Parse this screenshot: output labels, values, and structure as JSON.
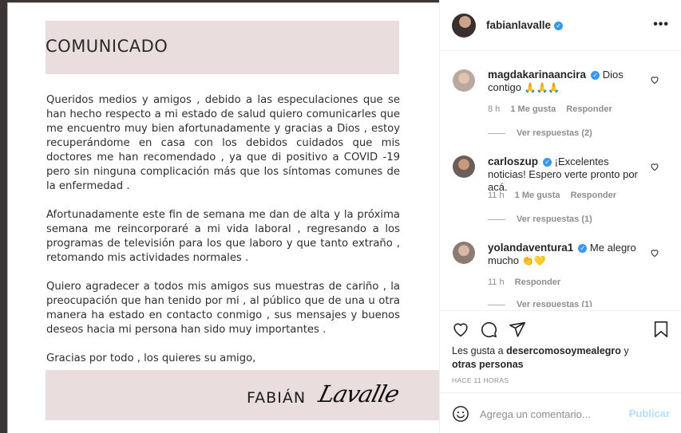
{
  "post": {
    "heading": "COMUNICADO",
    "paragraphs": [
      "Queridos medios y amigos , debido a las especulaciones que se han hecho respecto a mi estado de salud quiero comunicarles que me encuentro muy bien afortunadamente y gracias a Dios , estoy recuperándome en casa con los debidos cuidados que mis doctores me han recomendado ,  ya que di positivo a COVID -19 pero sin ninguna complicación más que los síntomas comunes de la enfermedad .",
      "Afortunadamente este fin de semana me dan de alta y la próxima semana me reincorporaré a mi vida laboral , regresando a los programas de televisión para los que laboro y que tanto  extraño , retomando mis actividades normales .",
      "Quiero agradecer a todos mis amigos sus muestras de cariño , la preocupación que han tenido  por mi , al público que de una u otra manera ha estado en contacto conmigo , sus mensajes y buenos deseos hacia mi persona han sido muy importantes .",
      "Gracias por todo , los quieres su amigo,"
    ],
    "signature_first": "FABIÁN",
    "signature_last": "Lavalle"
  },
  "header": {
    "username": "fabianlavalle",
    "verified_mark": "✓",
    "more": "•••"
  },
  "comments": [
    {
      "username": "magdakarinaancira",
      "verified": true,
      "text": "Dios contigo",
      "emoji": "🙏🙏🙏",
      "time": "8 h",
      "likes": "1 Me gusta",
      "reply": "Responder",
      "view_replies": "Ver respuestas (2)"
    },
    {
      "username": "carloszup",
      "verified": true,
      "text": "¡Excelentes noticias! Espero verte pronto por acá.",
      "emoji": "",
      "time": "11 h",
      "likes": "1 Me gusta",
      "reply": "Responder",
      "view_replies": "Ver respuestas (1)"
    },
    {
      "username": "yolandaventura1",
      "verified": true,
      "text": "Me alegro mucho",
      "emoji": "👏💛",
      "time": "11 h",
      "likes": "",
      "reply": "Responder",
      "view_replies": "Ver respuestas (1)"
    }
  ],
  "actions": {
    "likes_prefix": "Les gusta a ",
    "likes_user": "desercomosoymealegro",
    "likes_suffix": " y ",
    "likes_others": "otras personas",
    "timestamp": "HACE 11 HORAS"
  },
  "composer": {
    "placeholder": "Agrega un comentario...",
    "publish": "Publicar"
  },
  "colors": {
    "accent_blue": "#3897f0",
    "band_pink": "#eaddde",
    "publish_disabled": "#b2dffc"
  }
}
